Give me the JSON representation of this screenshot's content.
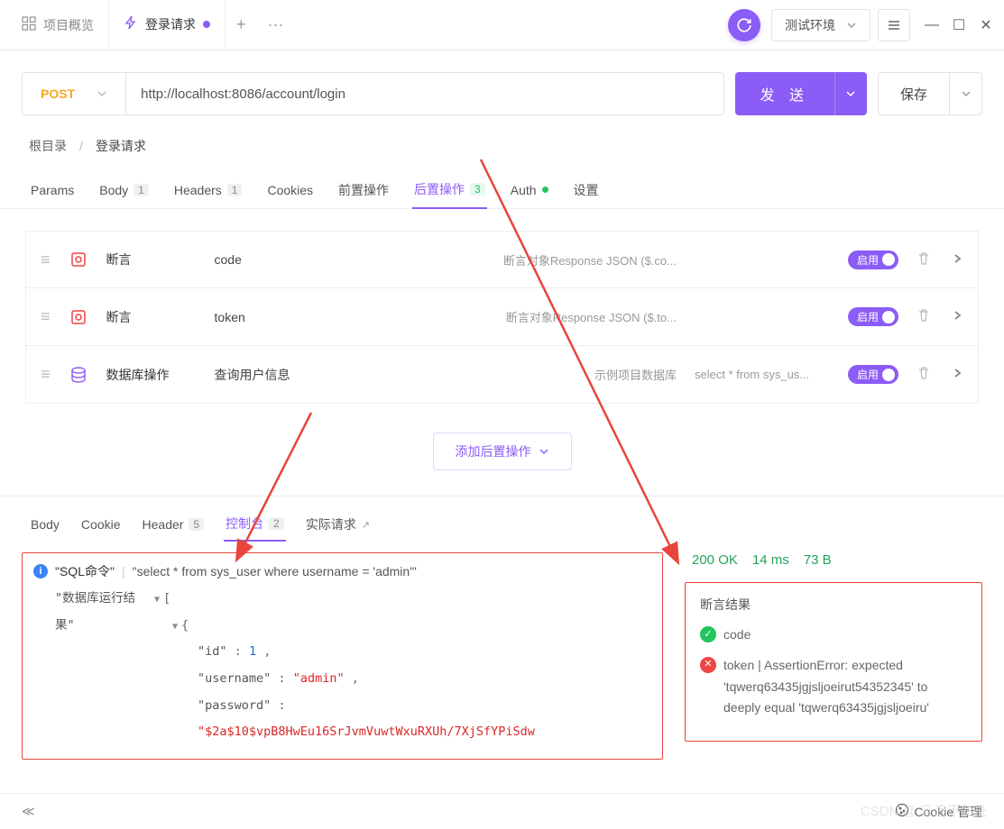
{
  "top": {
    "overview_label": "项目概览",
    "active_tab_label": "登录请求",
    "env_label": "测试环境"
  },
  "request": {
    "method": "POST",
    "url": "http://localhost:8086/account/login",
    "send_label": "发 送",
    "save_label": "保存"
  },
  "breadcrumb": {
    "root": "根目录",
    "current": "登录请求"
  },
  "req_tabs": {
    "params": "Params",
    "body": "Body",
    "body_count": "1",
    "headers": "Headers",
    "headers_count": "1",
    "cookies": "Cookies",
    "pre": "前置操作",
    "post": "后置操作",
    "post_count": "3",
    "auth": "Auth",
    "settings": "设置"
  },
  "ops": [
    {
      "type": "断言",
      "name": "code",
      "meta1": "断言对象Response JSON ($.co...",
      "meta2": "",
      "enable": "启用"
    },
    {
      "type": "断言",
      "name": "token",
      "meta1": "断言对象Response JSON ($.to...",
      "meta2": "",
      "enable": "启用"
    },
    {
      "type": "数据库操作",
      "name": "查询用户信息",
      "meta1": "示例项目数据库",
      "meta2": "select * from sys_us...",
      "enable": "启用"
    }
  ],
  "add_op_label": "添加后置操作",
  "resp_tabs": {
    "body": "Body",
    "cookie": "Cookie",
    "header": "Header",
    "header_count": "5",
    "console": "控制台",
    "console_count": "2",
    "actual": "实际请求"
  },
  "status": {
    "code": "200 OK",
    "time": "14 ms",
    "size": "73 B"
  },
  "console": {
    "sql_label": "\"SQL命令\"",
    "sql_value": "\"select * from sys_user where username = 'admin'\"",
    "result_label": "\"数据库运行结果\"",
    "json": {
      "id_key": "\"id\"",
      "id_val": "1",
      "username_key": "\"username\"",
      "username_val": "\"admin\"",
      "password_key": "\"password\"",
      "password_val": "\"$2a$10$vpB8HwEu16SrJvmVuwtWxuRXUh/7XjSfYPiSdw"
    }
  },
  "assertion": {
    "title": "断言结果",
    "ok_label": "code",
    "err_label": "token | AssertionError: expected 'tqwerq63435jgjsljoeirut54352345' to deeply equal 'tqwerq63435jgjsljoeiru'"
  },
  "footer": {
    "cookie_mgr": "Cookie 管理"
  },
  "watermark": "CSDN @ 云浪不知处"
}
